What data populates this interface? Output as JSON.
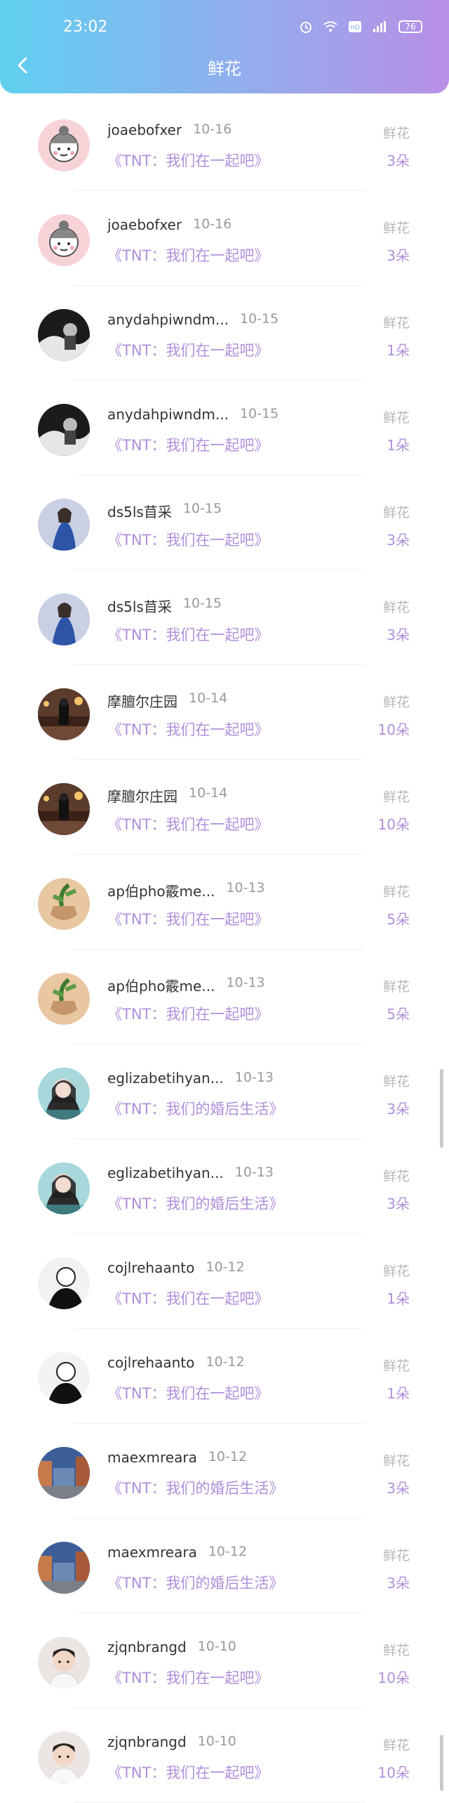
{
  "status_bar": {
    "time": "23:02",
    "battery": "76",
    "icons": [
      "alarm-icon",
      "wifi-icon",
      "hd-icon",
      "signal-icon",
      "battery-icon"
    ]
  },
  "header": {
    "title": "鲜花",
    "back_icon": "chevron-left-icon"
  },
  "colors": {
    "accent": "#b08fdb",
    "header_gradient_start": "#5fd0f0",
    "header_gradient_end": "#b88fe6"
  },
  "items": [
    {
      "name": "joaebofxer",
      "date": "10-16",
      "book": "《TNT：我们在一起吧》",
      "gift": "鲜花",
      "count": "3朵",
      "avatar": "cartoon-girl"
    },
    {
      "name": "joaebofxer",
      "date": "10-16",
      "book": "《TNT：我们在一起吧》",
      "gift": "鲜花",
      "count": "3朵",
      "avatar": "cartoon-girl"
    },
    {
      "name": "anydahpiwndm...",
      "date": "10-15",
      "book": "《TNT：我们在一起吧》",
      "gift": "鲜花",
      "count": "1朵",
      "avatar": "dark-photo"
    },
    {
      "name": "anydahpiwndm...",
      "date": "10-15",
      "book": "《TNT：我们在一起吧》",
      "gift": "鲜花",
      "count": "1朵",
      "avatar": "dark-photo"
    },
    {
      "name": "ds5ls苜采",
      "date": "10-15",
      "book": "《TNT：我们在一起吧》",
      "gift": "鲜花",
      "count": "3朵",
      "avatar": "blue-figure"
    },
    {
      "name": "ds5ls苜采",
      "date": "10-15",
      "book": "《TNT：我们在一起吧》",
      "gift": "鲜花",
      "count": "3朵",
      "avatar": "blue-figure"
    },
    {
      "name": "摩膻尔庄园",
      "date": "10-14",
      "book": "《TNT：我们在一起吧》",
      "gift": "鲜花",
      "count": "10朵",
      "avatar": "night-street"
    },
    {
      "name": "摩膻尔庄园",
      "date": "10-14",
      "book": "《TNT：我们在一起吧》",
      "gift": "鲜花",
      "count": "10朵",
      "avatar": "night-street"
    },
    {
      "name": "ap伯pho霰me...",
      "date": "10-13",
      "book": "《TNT：我们在一起吧》",
      "gift": "鲜花",
      "count": "5朵",
      "avatar": "plant-pot"
    },
    {
      "name": "ap伯pho霰me...",
      "date": "10-13",
      "book": "《TNT：我们在一起吧》",
      "gift": "鲜花",
      "count": "5朵",
      "avatar": "plant-pot"
    },
    {
      "name": "eglizabetihyan...",
      "date": "10-13",
      "book": "《TNT：我们的婚后生活》",
      "gift": "鲜花",
      "count": "3朵",
      "avatar": "portrait-teal"
    },
    {
      "name": "eglizabetihyan...",
      "date": "10-13",
      "book": "《TNT：我们的婚后生活》",
      "gift": "鲜花",
      "count": "3朵",
      "avatar": "portrait-teal"
    },
    {
      "name": "cojlrehaanto",
      "date": "10-12",
      "book": "《TNT：我们在一起吧》",
      "gift": "鲜花",
      "count": "1朵",
      "avatar": "bw-sketch"
    },
    {
      "name": "cojlrehaanto",
      "date": "10-12",
      "book": "《TNT：我们在一起吧》",
      "gift": "鲜花",
      "count": "1朵",
      "avatar": "bw-sketch"
    },
    {
      "name": "maexmreara",
      "date": "10-12",
      "book": "《TNT：我们的婚后生活》",
      "gift": "鲜花",
      "count": "3朵",
      "avatar": "city-street"
    },
    {
      "name": "maexmreara",
      "date": "10-12",
      "book": "《TNT：我们的婚后生活》",
      "gift": "鲜花",
      "count": "3朵",
      "avatar": "city-street"
    },
    {
      "name": "zjqnbrangd",
      "date": "10-10",
      "book": "《TNT：我们在一起吧》",
      "gift": "鲜花",
      "count": "10朵",
      "avatar": "boy-portrait"
    },
    {
      "name": "zjqnbrangd",
      "date": "10-10",
      "book": "《TNT：我们在一起吧》",
      "gift": "鲜花",
      "count": "10朵",
      "avatar": "boy-portrait"
    }
  ]
}
